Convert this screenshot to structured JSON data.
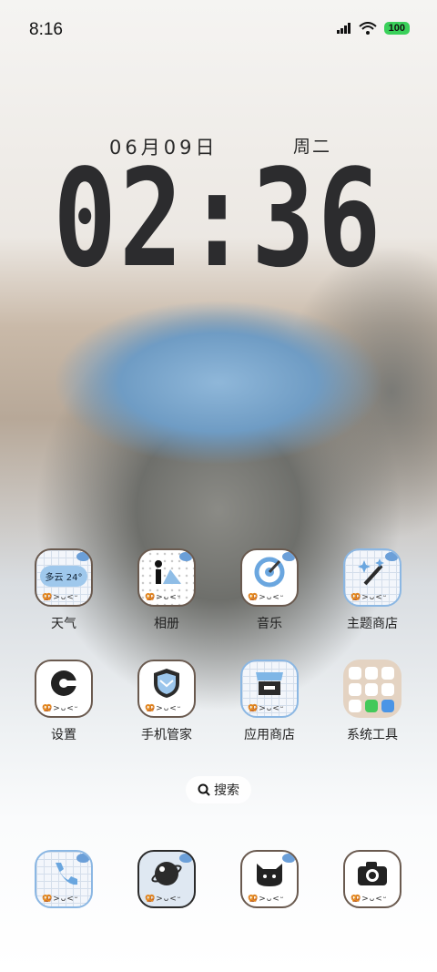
{
  "status": {
    "time": "8:16",
    "battery": "100"
  },
  "lockclock": {
    "date": "06月09日",
    "weekday": "周二",
    "time": "02:36"
  },
  "apps": [
    {
      "label": "天气",
      "icon": "weather-icon",
      "detail": "多云 24°"
    },
    {
      "label": "相册",
      "icon": "gallery-icon"
    },
    {
      "label": "音乐",
      "icon": "music-icon"
    },
    {
      "label": "主题商店",
      "icon": "theme-store-icon"
    },
    {
      "label": "设置",
      "icon": "settings-icon"
    },
    {
      "label": "手机管家",
      "icon": "phone-manager-icon"
    },
    {
      "label": "应用商店",
      "icon": "app-store-icon"
    },
    {
      "label": "系统工具",
      "icon": "system-tools-folder-icon"
    }
  ],
  "search": {
    "label": "搜索"
  },
  "dock": [
    {
      "icon": "phone-icon"
    },
    {
      "icon": "browser-icon"
    },
    {
      "icon": "cat-icon"
    },
    {
      "icon": "camera-icon"
    }
  ],
  "icon_strip": "🥨>ᴗ<ᵕ",
  "colors": {
    "accent_blue": "#6b9fd8",
    "battery": "#3ad05a",
    "icon_border": "#6a5a4f"
  }
}
